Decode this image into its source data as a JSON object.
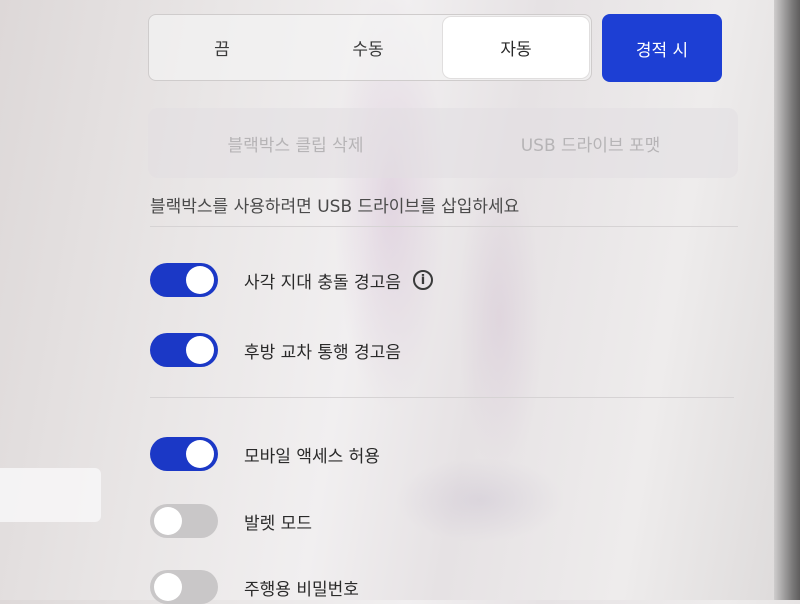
{
  "mode_selector": {
    "options": [
      {
        "label": "끔"
      },
      {
        "label": "수동"
      },
      {
        "label": "자동"
      }
    ],
    "selected_index": 2
  },
  "alarm_button": {
    "label": "경적 시"
  },
  "dashcam_actions": {
    "delete_clips": "블랙박스 클립 삭제",
    "format_usb": "USB 드라이브 포맷"
  },
  "usb_notice": "블랙박스를 사용하려면 USB 드라이브를 삽입하세요",
  "settings": [
    {
      "label": "사각 지대 충돌 경고음",
      "enabled": true,
      "has_info": true
    },
    {
      "label": "후방 교차 통행 경고음",
      "enabled": true,
      "has_info": false
    },
    {
      "label": "모바일 액세스 허용",
      "enabled": true,
      "has_info": false
    },
    {
      "label": "발렛 모드",
      "enabled": false,
      "has_info": false
    },
    {
      "label": "주행용 비밀번호",
      "enabled": false,
      "has_info": false
    }
  ],
  "colors": {
    "accent": "#1d3fd4",
    "toggle_on": "#1b38c6",
    "toggle_off": "#c9c7c8"
  },
  "icons": {
    "info": "info-circle-icon"
  }
}
